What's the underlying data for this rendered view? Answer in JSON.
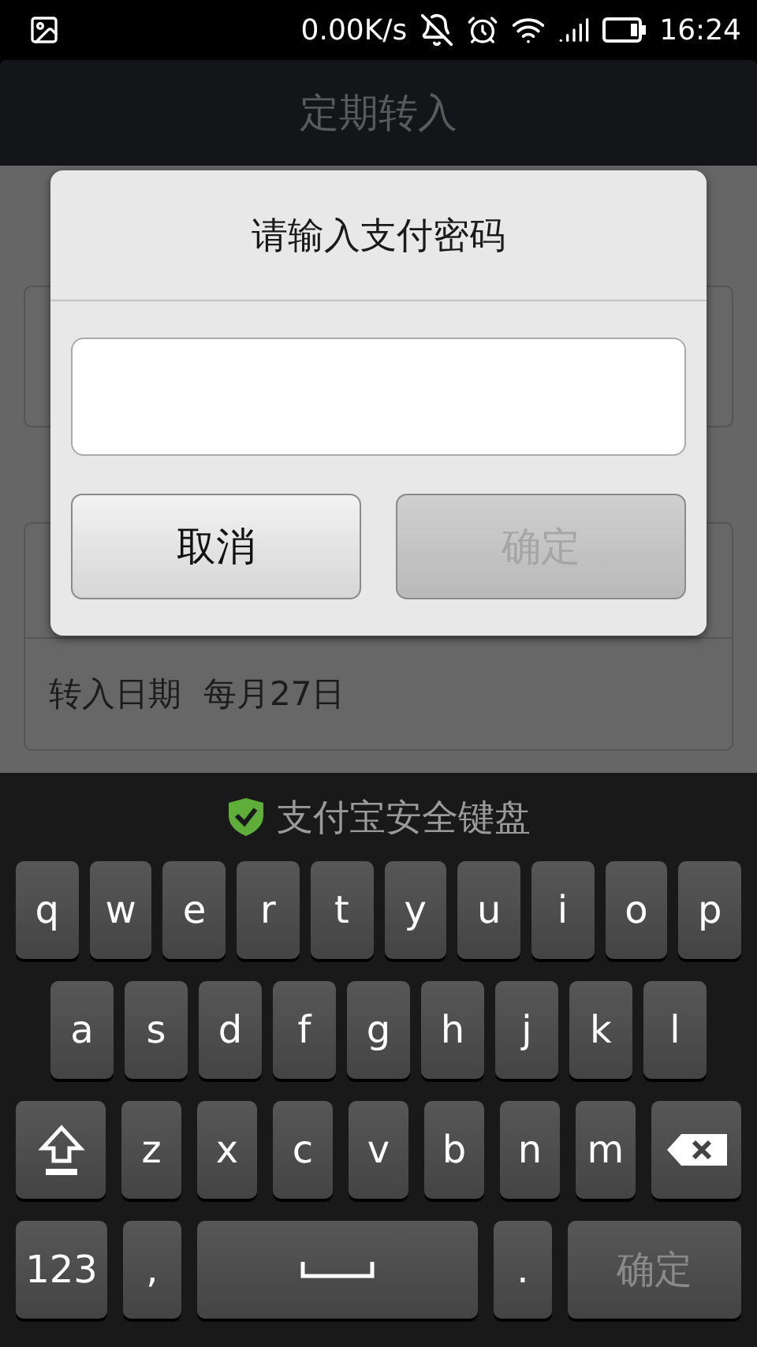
{
  "status_bar": {
    "speed": "0.00K/s",
    "time": "16:24"
  },
  "page": {
    "title": "定期转入",
    "rows": [
      {
        "label": "转入日期",
        "value": "每月27日"
      }
    ]
  },
  "dialog": {
    "title": "请输入支付密码",
    "buttons": [
      {
        "label": "取消",
        "disabled": false
      },
      {
        "label": "确定",
        "disabled": true
      }
    ]
  },
  "keyboard": {
    "title": "支付宝安全键盘",
    "rows": [
      {
        "keys": [
          {
            "kind": "letter",
            "label": "q"
          },
          {
            "kind": "letter",
            "label": "w"
          },
          {
            "kind": "letter",
            "label": "e"
          },
          {
            "kind": "letter",
            "label": "r"
          },
          {
            "kind": "letter",
            "label": "t"
          },
          {
            "kind": "letter",
            "label": "y"
          },
          {
            "kind": "letter",
            "label": "u"
          },
          {
            "kind": "letter",
            "label": "i"
          },
          {
            "kind": "letter",
            "label": "o"
          },
          {
            "kind": "letter",
            "label": "p"
          }
        ]
      },
      {
        "keys": [
          {
            "kind": "letter",
            "label": "a"
          },
          {
            "kind": "letter",
            "label": "s"
          },
          {
            "kind": "letter",
            "label": "d"
          },
          {
            "kind": "letter",
            "label": "f"
          },
          {
            "kind": "letter",
            "label": "g"
          },
          {
            "kind": "letter",
            "label": "h"
          },
          {
            "kind": "letter",
            "label": "j"
          },
          {
            "kind": "letter",
            "label": "k"
          },
          {
            "kind": "letter",
            "label": "l"
          }
        ]
      },
      {
        "keys": [
          {
            "kind": "shift"
          },
          {
            "kind": "letter",
            "label": "z"
          },
          {
            "kind": "letter",
            "label": "x"
          },
          {
            "kind": "letter",
            "label": "c"
          },
          {
            "kind": "letter",
            "label": "v"
          },
          {
            "kind": "letter",
            "label": "b"
          },
          {
            "kind": "letter",
            "label": "n"
          },
          {
            "kind": "letter",
            "label": "m"
          },
          {
            "kind": "backspace"
          }
        ]
      },
      {
        "keys": [
          {
            "kind": "mode",
            "label": "123"
          },
          {
            "kind": "punct",
            "label": ","
          },
          {
            "kind": "space"
          },
          {
            "kind": "punct",
            "label": "."
          },
          {
            "kind": "action",
            "label": "确定",
            "disabled": true
          }
        ]
      }
    ]
  }
}
